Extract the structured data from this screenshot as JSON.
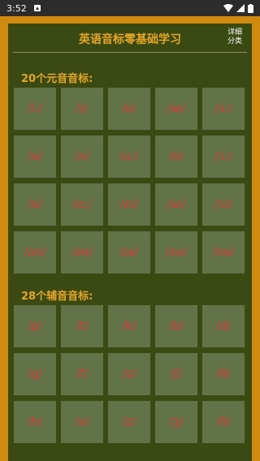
{
  "status_bar": {
    "time": "3:52",
    "icons": [
      "notification-icon",
      "wifi-icon",
      "signal-icon",
      "battery-icon"
    ]
  },
  "header": {
    "title": "英语音标零基础学习",
    "detail_line1": "详细",
    "detail_line2": "分类"
  },
  "vowels": {
    "title": "20个元音音标:",
    "items": [
      "/iː/",
      "/ɪ/",
      "/e/",
      "/æ/",
      "/ɜː/",
      "/ə/",
      "/ʌ/",
      "/uː/",
      "/ʊ/",
      "/ɔː/",
      "/ɒ/",
      "/ɑː/",
      "/eɪ/",
      "/aɪ/",
      "/ɔɪ/",
      "/aʊ/",
      "/əʊ/",
      "/ɪə/",
      "/eə/",
      "/ʊə/"
    ]
  },
  "consonants": {
    "title": "28个辅音音标:",
    "items": [
      "/p/",
      "/t/",
      "/k/",
      "/b/",
      "/d/",
      "/g/",
      "/f/",
      "/s/",
      "/ʃ/",
      "/θ/",
      "/h/",
      "/v/",
      "/z/",
      "/ʒ/",
      "/ð/"
    ]
  },
  "colors": {
    "background": "#d18a10",
    "panel": "#3a4a12",
    "cell": "#637349",
    "title_text": "#e5a52a",
    "phoneme_text": "#d63a3a"
  }
}
